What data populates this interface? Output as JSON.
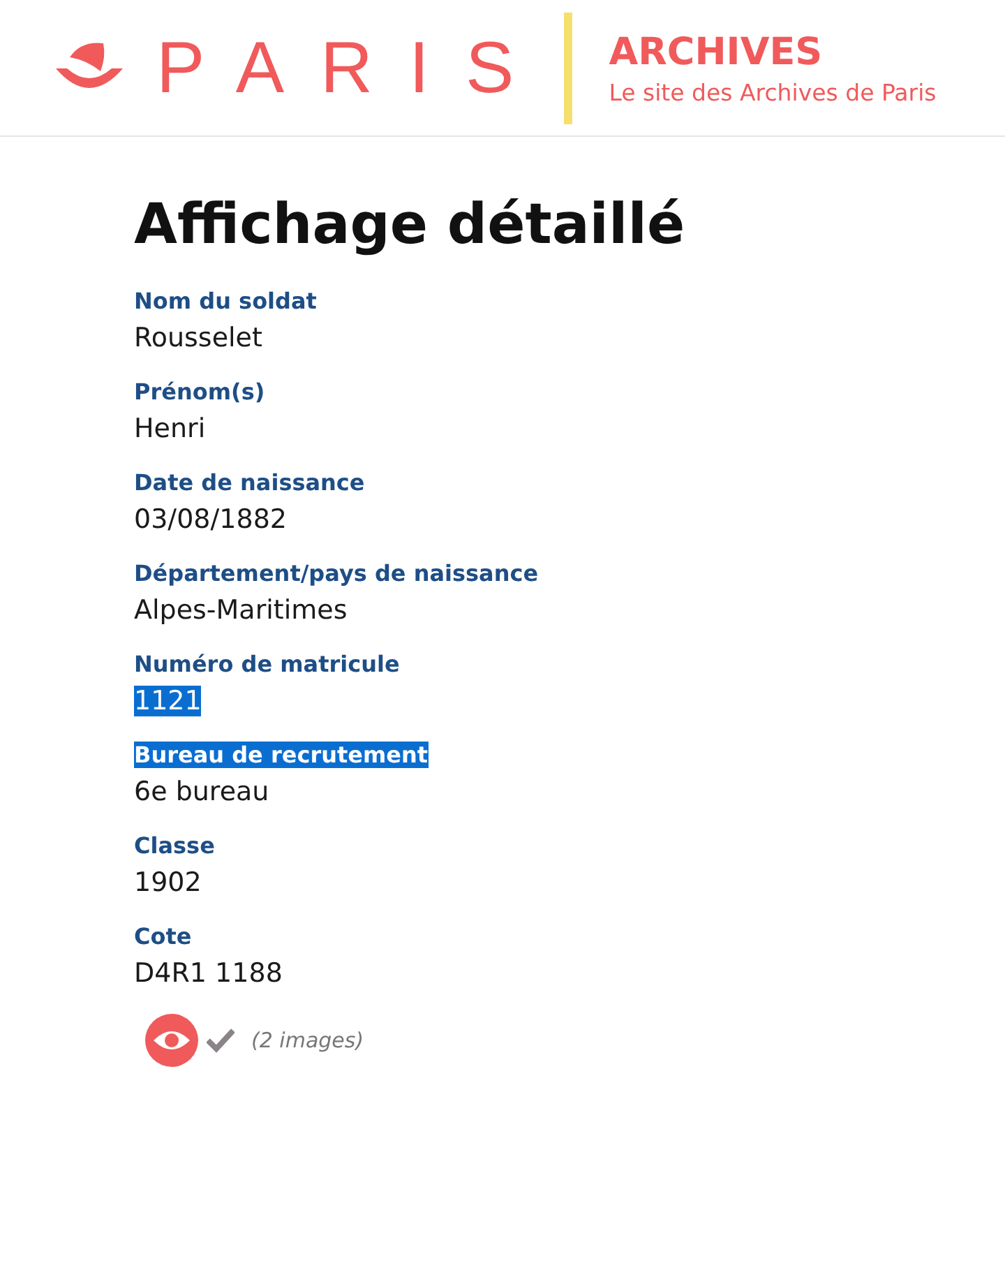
{
  "header": {
    "logo_text": "PARIS",
    "site_title": "ARCHIVES",
    "site_subtitle": "Le site des Archives de Paris"
  },
  "page_title": "Affichage détaillé",
  "fields": [
    {
      "label": "Nom du soldat",
      "value": "Rousselet",
      "label_highlighted": false,
      "value_highlighted": false
    },
    {
      "label": "Prénom(s)",
      "value": "Henri",
      "label_highlighted": false,
      "value_highlighted": false
    },
    {
      "label": "Date de naissance",
      "value": "03/08/1882",
      "label_highlighted": false,
      "value_highlighted": false
    },
    {
      "label": "Département/pays de naissance",
      "value": "Alpes-Maritimes",
      "label_highlighted": false,
      "value_highlighted": false
    },
    {
      "label": "Numéro de matricule",
      "value": "1121",
      "label_highlighted": false,
      "value_highlighted": true
    },
    {
      "label": "Bureau de recrutement",
      "value": "6e bureau",
      "label_highlighted": true,
      "value_highlighted": false
    },
    {
      "label": "Classe",
      "value": "1902",
      "label_highlighted": false,
      "value_highlighted": false
    },
    {
      "label": "Cote",
      "value": "D4R1 1188",
      "label_highlighted": false,
      "value_highlighted": false
    }
  ],
  "images_count": "(2 images)"
}
